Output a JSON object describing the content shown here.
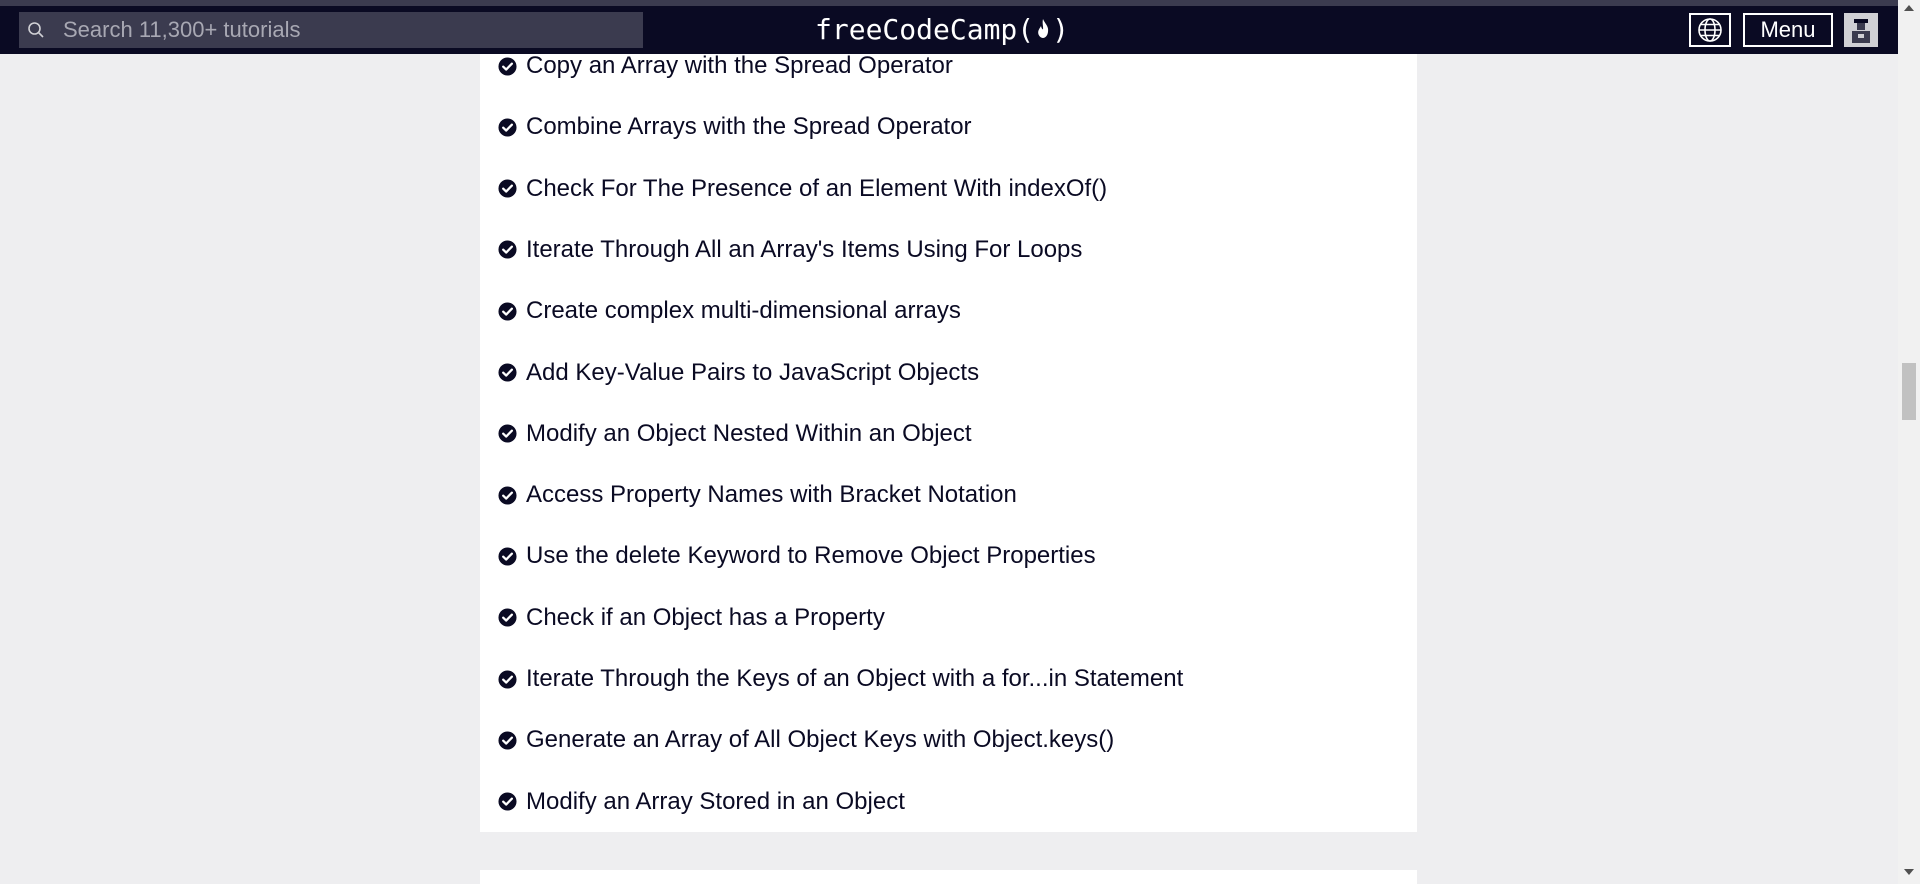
{
  "header": {
    "search_placeholder": "Search 11,300+ tutorials",
    "logo_text": "freeCodeCamp(",
    "logo_close": ")",
    "menu_label": "Menu",
    "bg_color": "#0a0a23",
    "search_bg": "#3b3b4f"
  },
  "icons": {
    "search": "search-icon",
    "flame": "flame-icon",
    "globe": "globe-icon",
    "avatar": "avatar-icon",
    "completed": "check-circle-icon"
  },
  "lessons": [
    "Copy an Array with the Spread Operator",
    "Combine Arrays with the Spread Operator",
    "Check For The Presence of an Element With indexOf()",
    "Iterate Through All an Array's Items Using For Loops",
    "Create complex multi-dimensional arrays",
    "Add Key-Value Pairs to JavaScript Objects",
    "Modify an Object Nested Within an Object",
    "Access Property Names with Bracket Notation",
    "Use the delete Keyword to Remove Object Properties",
    "Check if an Object has a Property",
    "Iterate Through the Keys of an Object with a for...in Statement",
    "Generate an Array of All Object Keys with Object.keys()",
    "Modify an Array Stored in an Object"
  ]
}
